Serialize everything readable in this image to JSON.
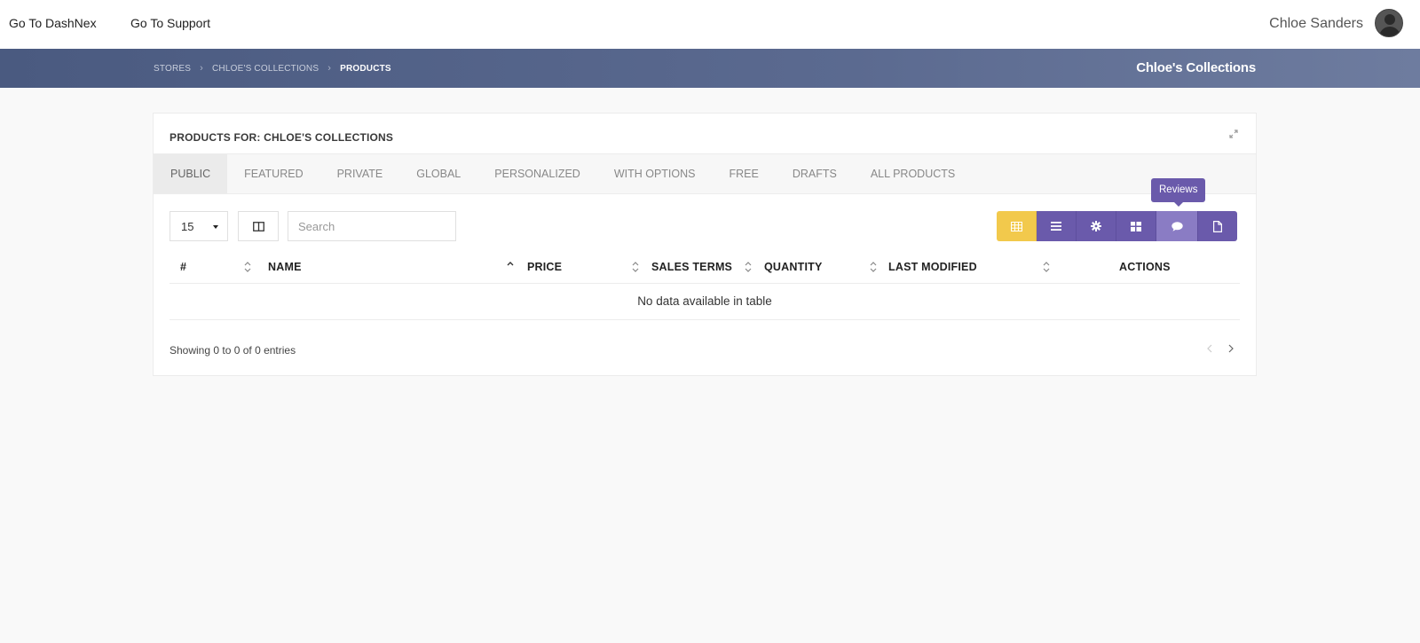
{
  "topbar": {
    "link_dashnex": "Go To DashNex",
    "link_support": "Go To Support",
    "user_name": "Chloe Sanders"
  },
  "header": {
    "breadcrumbs": [
      "STORES",
      "CHLOE'S COLLECTIONS",
      "PRODUCTS"
    ],
    "store_title": "Chloe's Collections"
  },
  "card": {
    "title": "PRODUCTS FOR: CHLOE'S COLLECTIONS",
    "tabs": [
      "PUBLIC",
      "FEATURED",
      "PRIVATE",
      "GLOBAL",
      "PERSONALIZED",
      "WITH OPTIONS",
      "FREE",
      "DRAFTS",
      "ALL PRODUCTS"
    ],
    "active_tab": "PUBLIC"
  },
  "controls": {
    "page_length": "15",
    "search_placeholder": "Search",
    "view_buttons": [
      "table-icon",
      "list-icon",
      "gear-icon",
      "grid-icon",
      "comment-icon",
      "file-icon"
    ],
    "tooltip": "Reviews"
  },
  "table": {
    "columns": [
      "#",
      "NAME",
      "PRICE",
      "SALES TERMS",
      "QUANTITY",
      "LAST MODIFIED",
      "ACTIONS"
    ],
    "empty_message": "No data available in table",
    "info": "Showing 0 to 0 of 0 entries"
  },
  "colors": {
    "accent_purple": "#6a5aab",
    "accent_yellow": "#f2c94c",
    "header_band": "#4a5a80"
  }
}
